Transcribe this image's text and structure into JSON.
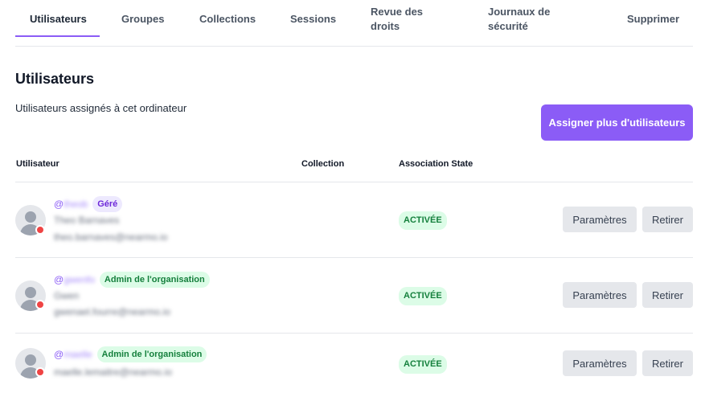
{
  "tabs": [
    {
      "label": "Utilisateurs",
      "active": true
    },
    {
      "label": "Groupes"
    },
    {
      "label": "Collections"
    },
    {
      "label": "Sessions"
    },
    {
      "label": "Revue des droits"
    },
    {
      "label": "Journaux de sécurité"
    },
    {
      "label": "Supprimer"
    }
  ],
  "accent_color": "#8b5cf6",
  "page_title": "Utilisateurs",
  "subtitle": "Utilisateurs assignés à cet ordinateur",
  "assign_button_label": "Assigner plus d'utilisateurs",
  "table": {
    "headers": {
      "user": "Utilisateur",
      "collection": "Collection",
      "state": "Association State"
    },
    "rows": [
      {
        "handle_prefix": "@",
        "handle": "theob",
        "role_badge": "Géré",
        "name": "Theo Barnaves",
        "email": "theo.barnaves@nearmo.io",
        "state": "ACTIVÉE",
        "settings_label": "Paramètres",
        "remove_label": "Retirer"
      },
      {
        "handle_prefix": "@",
        "handle": "gwenfo",
        "role_badge": "Admin de l'organisation",
        "name": "Gwen",
        "email": "gwenael.fourre@nearmo.io",
        "state": "ACTIVÉE",
        "settings_label": "Paramètres",
        "remove_label": "Retirer"
      },
      {
        "handle_prefix": "@",
        "handle": "maelle",
        "role_badge": "Admin de l'organisation",
        "name": "",
        "email": "maelle.lemaitre@nearmo.io",
        "state": "ACTIVÉE",
        "settings_label": "Paramètres",
        "remove_label": "Retirer"
      }
    ]
  }
}
